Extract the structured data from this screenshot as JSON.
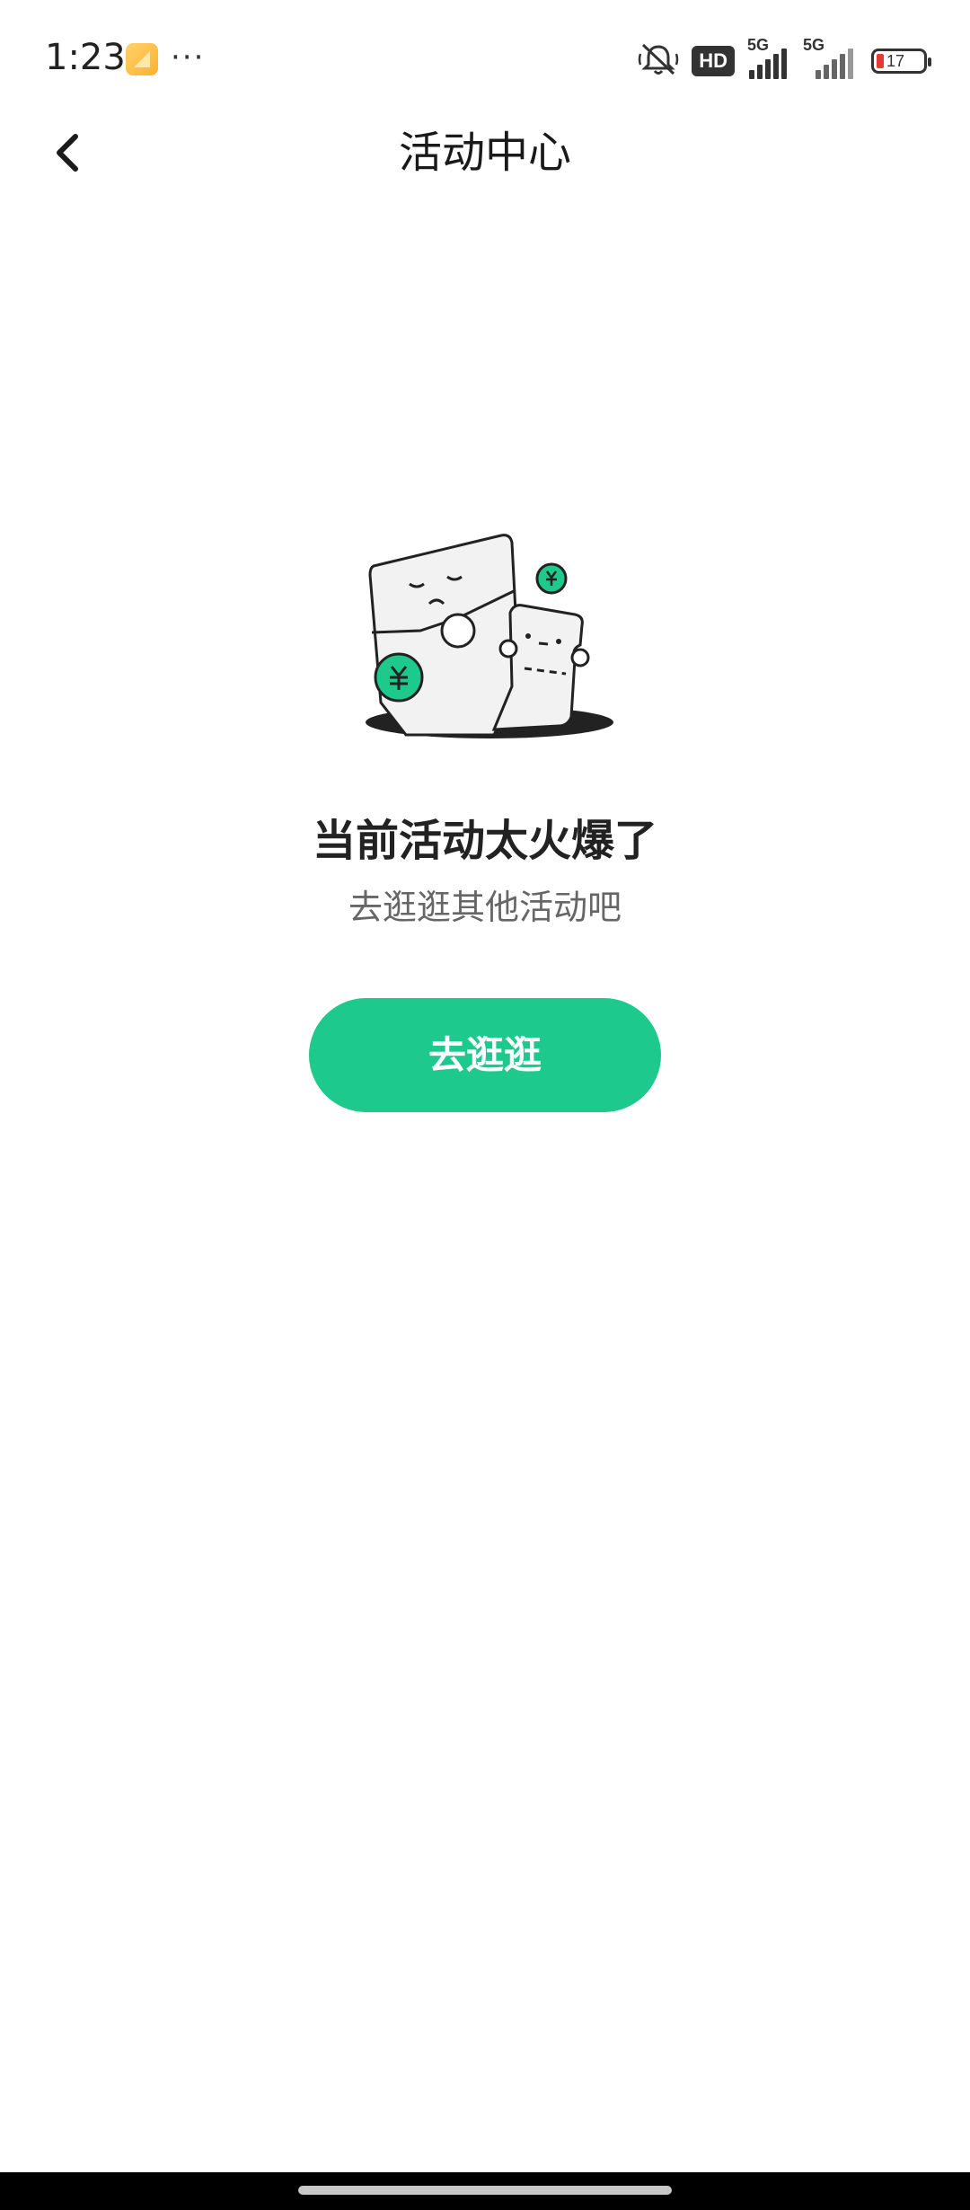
{
  "status_bar": {
    "time": "1:23",
    "more": "···",
    "hd_label": "HD",
    "signal1_label": "5G",
    "signal2_label": "5G",
    "battery_level": "17",
    "battery_color": "#e53935"
  },
  "nav": {
    "title": "活动中心",
    "back_icon": "chevron-left-icon"
  },
  "empty_state": {
    "title": "当前活动太火爆了",
    "subtitle": "去逛逛其他活动吧",
    "button_label": "去逛逛",
    "button_color": "#1ec98e",
    "illustration": "empty-envelope-illustration"
  }
}
